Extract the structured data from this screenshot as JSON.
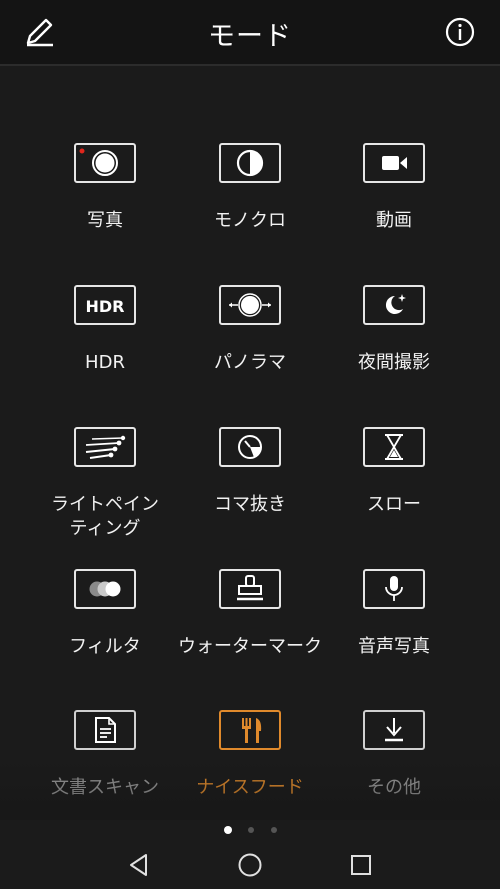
{
  "header": {
    "title": "モード",
    "edit_icon": "pencil-icon",
    "info_icon": "info-icon"
  },
  "modes": [
    {
      "label": "写真",
      "icon": "photo-icon"
    },
    {
      "label": "モノクロ",
      "icon": "monochrome-icon"
    },
    {
      "label": "動画",
      "icon": "video-icon"
    },
    {
      "label": "HDR",
      "icon": "hdr-icon"
    },
    {
      "label": "パノラマ",
      "icon": "panorama-icon"
    },
    {
      "label": "夜間撮影",
      "icon": "night-icon"
    },
    {
      "label": "ライトペイン\nティング",
      "icon": "light-painting-icon"
    },
    {
      "label": "コマ抜き",
      "icon": "time-lapse-icon"
    },
    {
      "label": "スロー",
      "icon": "hourglass-icon"
    },
    {
      "label": "フィルタ",
      "icon": "filter-icon"
    },
    {
      "label": "ウォーターマーク",
      "icon": "watermark-stamp-icon"
    },
    {
      "label": "音声写真",
      "icon": "microphone-icon"
    },
    {
      "label": "文書スキャン",
      "icon": "document-icon"
    },
    {
      "label": "ナイスフード",
      "icon": "fork-knife-icon"
    },
    {
      "label": "その他",
      "icon": "download-icon"
    }
  ],
  "active_mode": "ナイスフード",
  "pagination": {
    "pages": 3,
    "current": 1
  },
  "navbar": [
    "back-icon",
    "home-icon",
    "recents-icon"
  ],
  "colors": {
    "accent": "#e08a2c",
    "background": "#1b1b1b",
    "record_dot": "#e0261c"
  }
}
